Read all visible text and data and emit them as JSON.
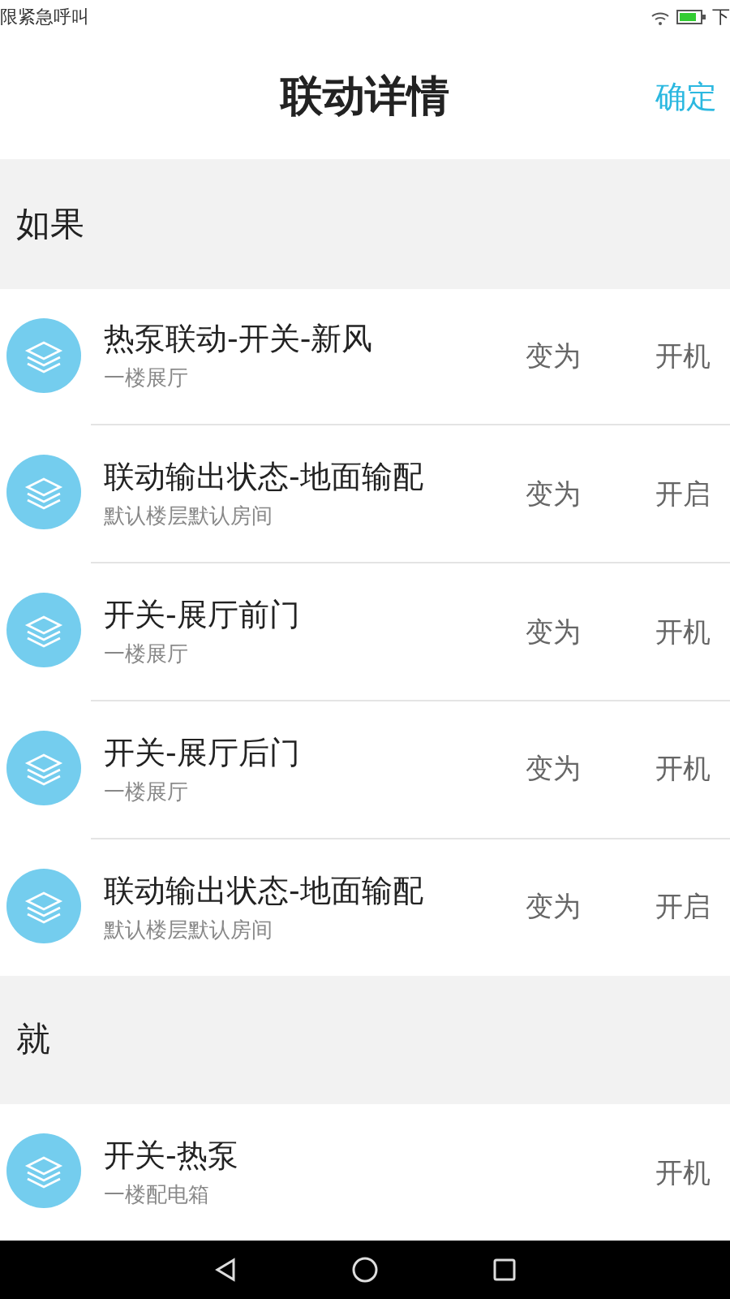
{
  "status_bar": {
    "carrier": "限紧急呼叫",
    "time": "下"
  },
  "header": {
    "title": "联动详情",
    "confirm": "确定"
  },
  "sections": [
    {
      "title": "如果",
      "rows": [
        {
          "name": "热泵联动-开关-新风",
          "location": "一楼展厅",
          "verb": "变为",
          "state": "开机"
        },
        {
          "name": "联动输出状态-地面输配",
          "location": "默认楼层默认房间",
          "verb": "变为",
          "state": "开启"
        },
        {
          "name": "开关-展厅前门",
          "location": "一楼展厅",
          "verb": "变为",
          "state": "开机"
        },
        {
          "name": "开关-展厅后门",
          "location": "一楼展厅",
          "verb": "变为",
          "state": "开机"
        },
        {
          "name": "联动输出状态-地面输配",
          "location": "默认楼层默认房间",
          "verb": "变为",
          "state": "开启"
        }
      ]
    },
    {
      "title": "就",
      "rows": [
        {
          "name": "开关-热泵",
          "location": "一楼配电箱",
          "state": "开机"
        }
      ]
    }
  ]
}
